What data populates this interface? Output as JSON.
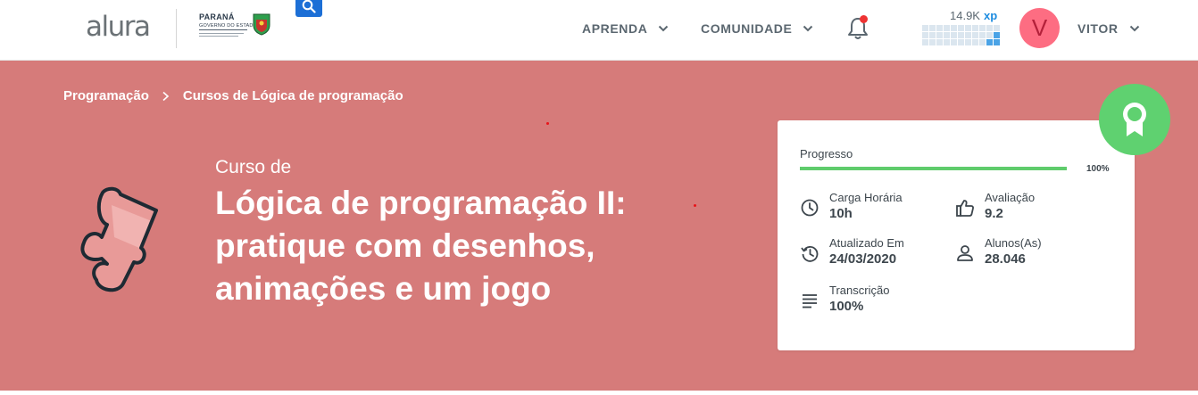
{
  "header": {
    "logo_text": "alura",
    "gov_logo": {
      "title": "PARANÁ",
      "subtitle": "GOVERNO DO ESTADO"
    },
    "search_icon": "search-icon",
    "nav": [
      {
        "label": "APRENDA"
      },
      {
        "label": "COMUNIDADE"
      }
    ],
    "notification_icon": "bell-icon",
    "xp": {
      "value": "14.9K",
      "unit": "xp",
      "level_cells_filled": 3,
      "level_cells_total": 33
    },
    "user": {
      "avatar_letter": "V",
      "avatar_color": "#fd6d82",
      "name": "VITOR"
    }
  },
  "hero": {
    "background_color": "#d67b7a",
    "breadcrumb": [
      {
        "label": "Programação"
      },
      {
        "label": "Cursos de Lógica de programação"
      }
    ],
    "course_pre": "Curso de",
    "course_title": "Lógica de programação II: pratique com desenhos, animações e um jogo",
    "category_icon": "puzzle-piece-icon"
  },
  "card": {
    "progress": {
      "label": "Progresso",
      "value": 1.0,
      "text": "100%",
      "color": "#5fcc6c"
    },
    "stats": {
      "carga": {
        "label": "Carga Horária",
        "value": "10h",
        "icon": "clock-icon"
      },
      "avaliacao": {
        "label": "Avaliação",
        "value": "9.2",
        "icon": "thumbs-up-icon"
      },
      "atualizado": {
        "label": "Atualizado Em",
        "value": "24/03/2020",
        "icon": "history-icon"
      },
      "alunos": {
        "label": "Alunos(As)",
        "value": "28.046",
        "icon": "user-icon"
      },
      "transcricao": {
        "label": "Transcrição",
        "value": "100%",
        "icon": "text-lines-icon"
      }
    }
  },
  "certificate_badge": {
    "icon": "award-ribbon-icon",
    "color": "#5fd170"
  }
}
